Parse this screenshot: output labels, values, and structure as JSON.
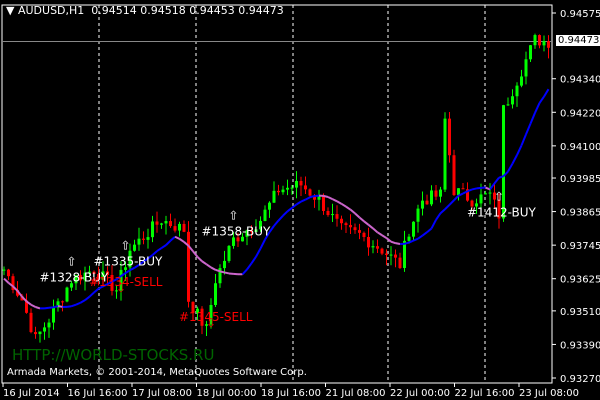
{
  "header": {
    "symbol": "AUDUSD,H1",
    "ohlc": "0.94514 0.94518 0.94453 0.94473"
  },
  "current_price": "0.94473",
  "watermark": "HTTP://WORLD-STOCKS.RU",
  "copyright": "Armada Markets, © 2001-2014, MetaQuotes Software Corp.",
  "colors": {
    "bull": "#00ff00",
    "bear": "#ff0000",
    "ma_up": "#0000ff",
    "ma_down": "#cc66cc",
    "buy_text": "#ffffff",
    "sell_text": "#ff0000",
    "watermark": "#006400"
  },
  "trades": [
    {
      "label": "#1328-BUY",
      "type": "buy",
      "index": 15
    },
    {
      "label": "#1335-BUY",
      "type": "buy",
      "index": 27
    },
    {
      "label": "#1334-SELL",
      "type": "sell",
      "index": 26
    },
    {
      "label": "#1345-SELL",
      "type": "sell",
      "index": 46
    },
    {
      "label": "#1358-BUY",
      "type": "buy",
      "index": 51
    },
    {
      "label": "#1412-BUY",
      "type": "buy",
      "index": 110
    }
  ],
  "chart_data": {
    "type": "candlestick",
    "title": "AUDUSD,H1",
    "ylim": [
      0.9327,
      0.94575
    ],
    "y_ticks": [
      "0.94575",
      "0.94340",
      "0.94220",
      "0.94100",
      "0.93985",
      "0.93865",
      "0.93745",
      "0.93625",
      "0.93510",
      "0.93390",
      "0.93270"
    ],
    "x_ticks": [
      "16 Jul 2014",
      "16 Jul 16:00",
      "17 Jul 08:00",
      "18 Jul 00:00",
      "18 Jul 16:00",
      "21 Jul 08:00",
      "22 Jul 00:00",
      "22 Jul 16:00",
      "23 Jul 08:00"
    ],
    "close_keypoints": [
      [
        0,
        0.93658
      ],
      [
        4,
        0.9355
      ],
      [
        7,
        0.93408
      ],
      [
        10,
        0.93479
      ],
      [
        15,
        0.93622
      ],
      [
        20,
        0.93658
      ],
      [
        25,
        0.93586
      ],
      [
        28,
        0.93729
      ],
      [
        35,
        0.93836
      ],
      [
        40,
        0.938
      ],
      [
        41,
        0.9355
      ],
      [
        45,
        0.93443
      ],
      [
        47,
        0.93622
      ],
      [
        51,
        0.93765
      ],
      [
        57,
        0.93836
      ],
      [
        61,
        0.93943
      ],
      [
        66,
        0.93961
      ],
      [
        70,
        0.93907
      ],
      [
        75,
        0.938
      ],
      [
        79,
        0.93782
      ],
      [
        84,
        0.93729
      ],
      [
        88,
        0.93675
      ],
      [
        90,
        0.938
      ],
      [
        93,
        0.93907
      ],
      [
        97,
        0.93925
      ],
      [
        98,
        0.94193
      ],
      [
        100,
        0.93943
      ],
      [
        104,
        0.93907
      ],
      [
        108,
        0.93925
      ],
      [
        110,
        0.93854
      ],
      [
        111,
        0.94229
      ],
      [
        115,
        0.94372
      ],
      [
        118,
        0.94479
      ],
      [
        121,
        0.94473
      ]
    ]
  }
}
